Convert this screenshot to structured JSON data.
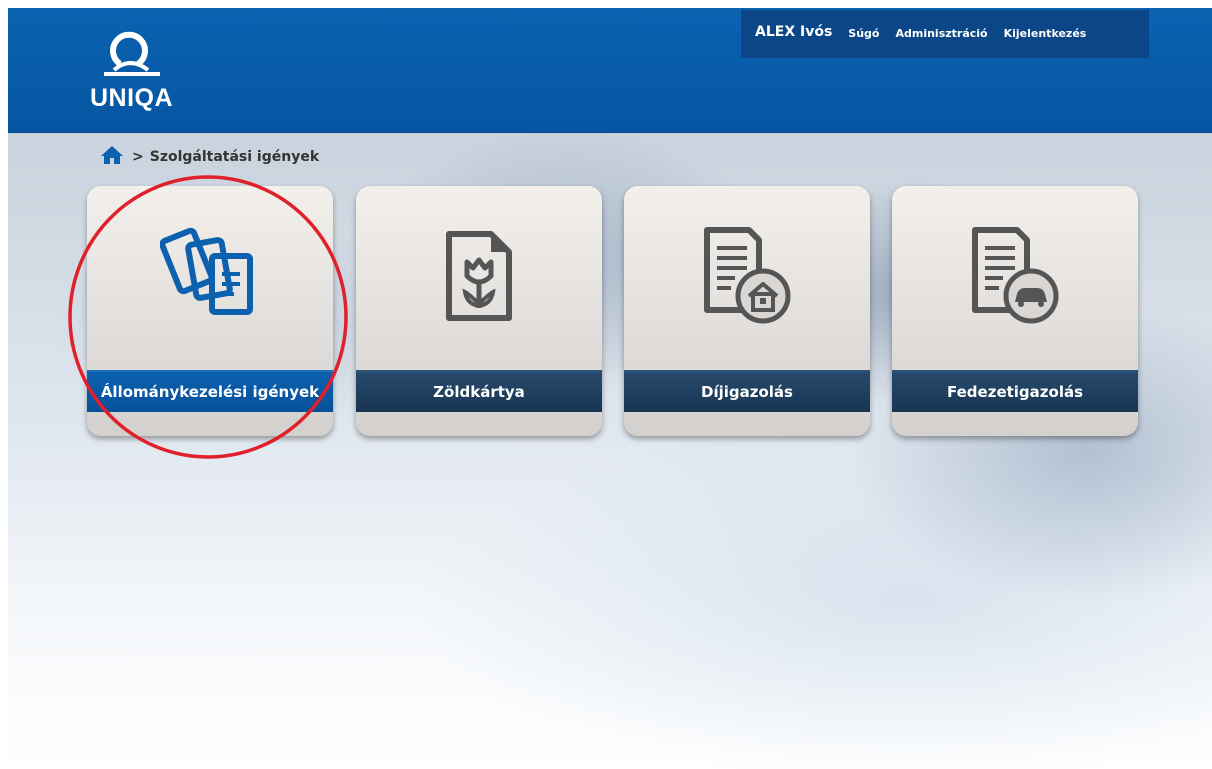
{
  "header": {
    "logo_text": "UNIQA",
    "user_name": "ALEX Ivós",
    "nav": [
      "Súgó",
      "Adminisztráció",
      "Kijelentkezés"
    ]
  },
  "breadcrumb": {
    "separator": ">",
    "current": "Szolgáltatási igények"
  },
  "tiles": [
    {
      "label": "Állománykezelési igények",
      "icon": "documents-icon",
      "active": true
    },
    {
      "label": "Zöldkártya",
      "icon": "flower-document-icon",
      "active": false
    },
    {
      "label": "Díjigazolás",
      "icon": "document-house-icon",
      "active": false
    },
    {
      "label": "Fedezetigazolás",
      "icon": "document-car-icon",
      "active": false
    }
  ],
  "colors": {
    "brand_blue": "#0a62b0",
    "tile_label": "#1f3f5f",
    "active_label": "#0b61ae",
    "icon_blue": "#0b61ae",
    "icon_gray": "#555555",
    "annotation_red": "#e0202a"
  }
}
